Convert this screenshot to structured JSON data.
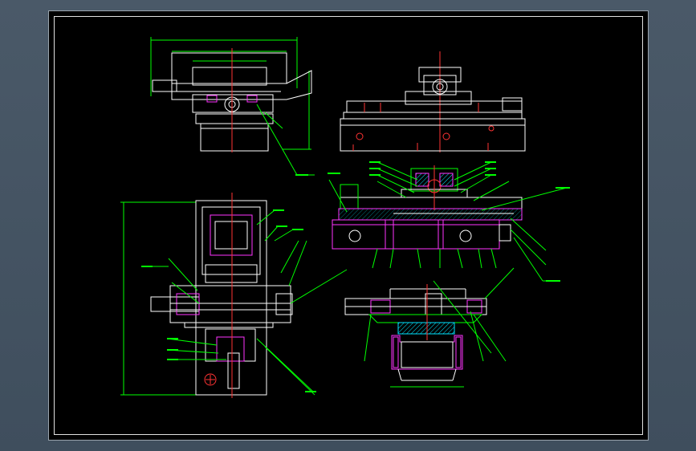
{
  "viewer": {
    "background": "#4a5968",
    "sheet_background": "#000000"
  },
  "palette": {
    "outline": "#ffffff",
    "section": "#ff33ff",
    "leader": "#00ff00",
    "centerline": "#ff3333",
    "dimension": "#00ff00",
    "hatch": "#00e5ff"
  },
  "views": {
    "top_left": "front-elevation",
    "bottom_left": "plan-view",
    "top_right": "side-elevation",
    "middle_right": "section-view",
    "bottom_right": "lower-section-view"
  }
}
